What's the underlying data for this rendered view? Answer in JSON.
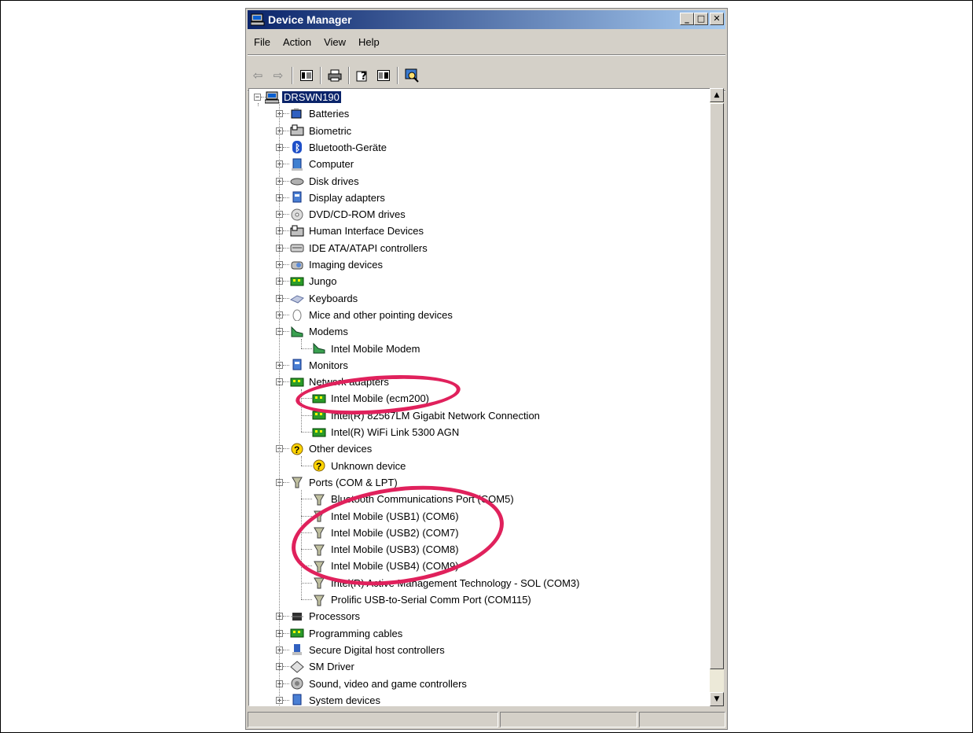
{
  "window": {
    "title": "Device Manager"
  },
  "menu": [
    "File",
    "Action",
    "View",
    "Help"
  ],
  "toolbar": [
    "back-icon",
    "forward-icon",
    "properties-icon",
    "print-icon",
    "help-icon",
    "view-icon",
    "scan-icon"
  ],
  "tree": {
    "root": "DRSWN190",
    "categories": [
      {
        "label": "Batteries",
        "icon": "battery-icon",
        "expanded": false
      },
      {
        "label": "Biometric",
        "icon": "biometric-icon",
        "expanded": false
      },
      {
        "label": "Bluetooth-Geräte",
        "icon": "bluetooth-icon",
        "expanded": false
      },
      {
        "label": "Computer",
        "icon": "computer-icon",
        "expanded": false
      },
      {
        "label": "Disk drives",
        "icon": "disk-icon",
        "expanded": false
      },
      {
        "label": "Display adapters",
        "icon": "display-icon",
        "expanded": false
      },
      {
        "label": "DVD/CD-ROM drives",
        "icon": "dvd-icon",
        "expanded": false
      },
      {
        "label": "Human Interface Devices",
        "icon": "hid-icon",
        "expanded": false
      },
      {
        "label": "IDE ATA/ATAPI controllers",
        "icon": "ide-icon",
        "expanded": false
      },
      {
        "label": "Imaging devices",
        "icon": "camera-icon",
        "expanded": false
      },
      {
        "label": "Jungo",
        "icon": "board-icon",
        "expanded": false
      },
      {
        "label": "Keyboards",
        "icon": "keyboard-icon",
        "expanded": false
      },
      {
        "label": "Mice and other pointing devices",
        "icon": "mouse-icon",
        "expanded": false
      },
      {
        "label": "Modems",
        "icon": "modem-icon",
        "expanded": true,
        "children": [
          "Intel Mobile Modem"
        ]
      },
      {
        "label": "Monitors",
        "icon": "monitor-icon",
        "expanded": false
      },
      {
        "label": "Network adapters",
        "icon": "network-icon",
        "expanded": true,
        "children": [
          "Intel Mobile (ecm200)",
          "Intel(R) 82567LM Gigabit Network Connection",
          "Intel(R) WiFi Link 5300 AGN"
        ]
      },
      {
        "label": "Other devices",
        "icon": "unknown-icon",
        "expanded": true,
        "children": [
          "Unknown device"
        ]
      },
      {
        "label": "Ports (COM & LPT)",
        "icon": "port-icon",
        "expanded": true,
        "children": [
          "Bluetooth Communications Port (COM5)",
          "Intel Mobile (USB1) (COM6)",
          "Intel Mobile (USB2) (COM7)",
          "Intel Mobile (USB3) (COM8)",
          "Intel Mobile (USB4) (COM9)",
          "Intel(R) Active Management Technology - SOL (COM3)",
          "Prolific USB-to-Serial Comm Port (COM115)"
        ]
      },
      {
        "label": "Processors",
        "icon": "cpu-icon",
        "expanded": false
      },
      {
        "label": "Programming cables",
        "icon": "board-icon",
        "expanded": false
      },
      {
        "label": "Secure Digital host controllers",
        "icon": "sd-icon",
        "expanded": false
      },
      {
        "label": "SM Driver",
        "icon": "diamond-icon",
        "expanded": false
      },
      {
        "label": "Sound, video and game controllers",
        "icon": "sound-icon",
        "expanded": false
      },
      {
        "label": "System devices",
        "icon": "system-icon",
        "expanded": false
      }
    ]
  },
  "colors": {
    "annotation": "#e0215c",
    "selection": "#0a246a",
    "window": "#d4d0c8"
  }
}
